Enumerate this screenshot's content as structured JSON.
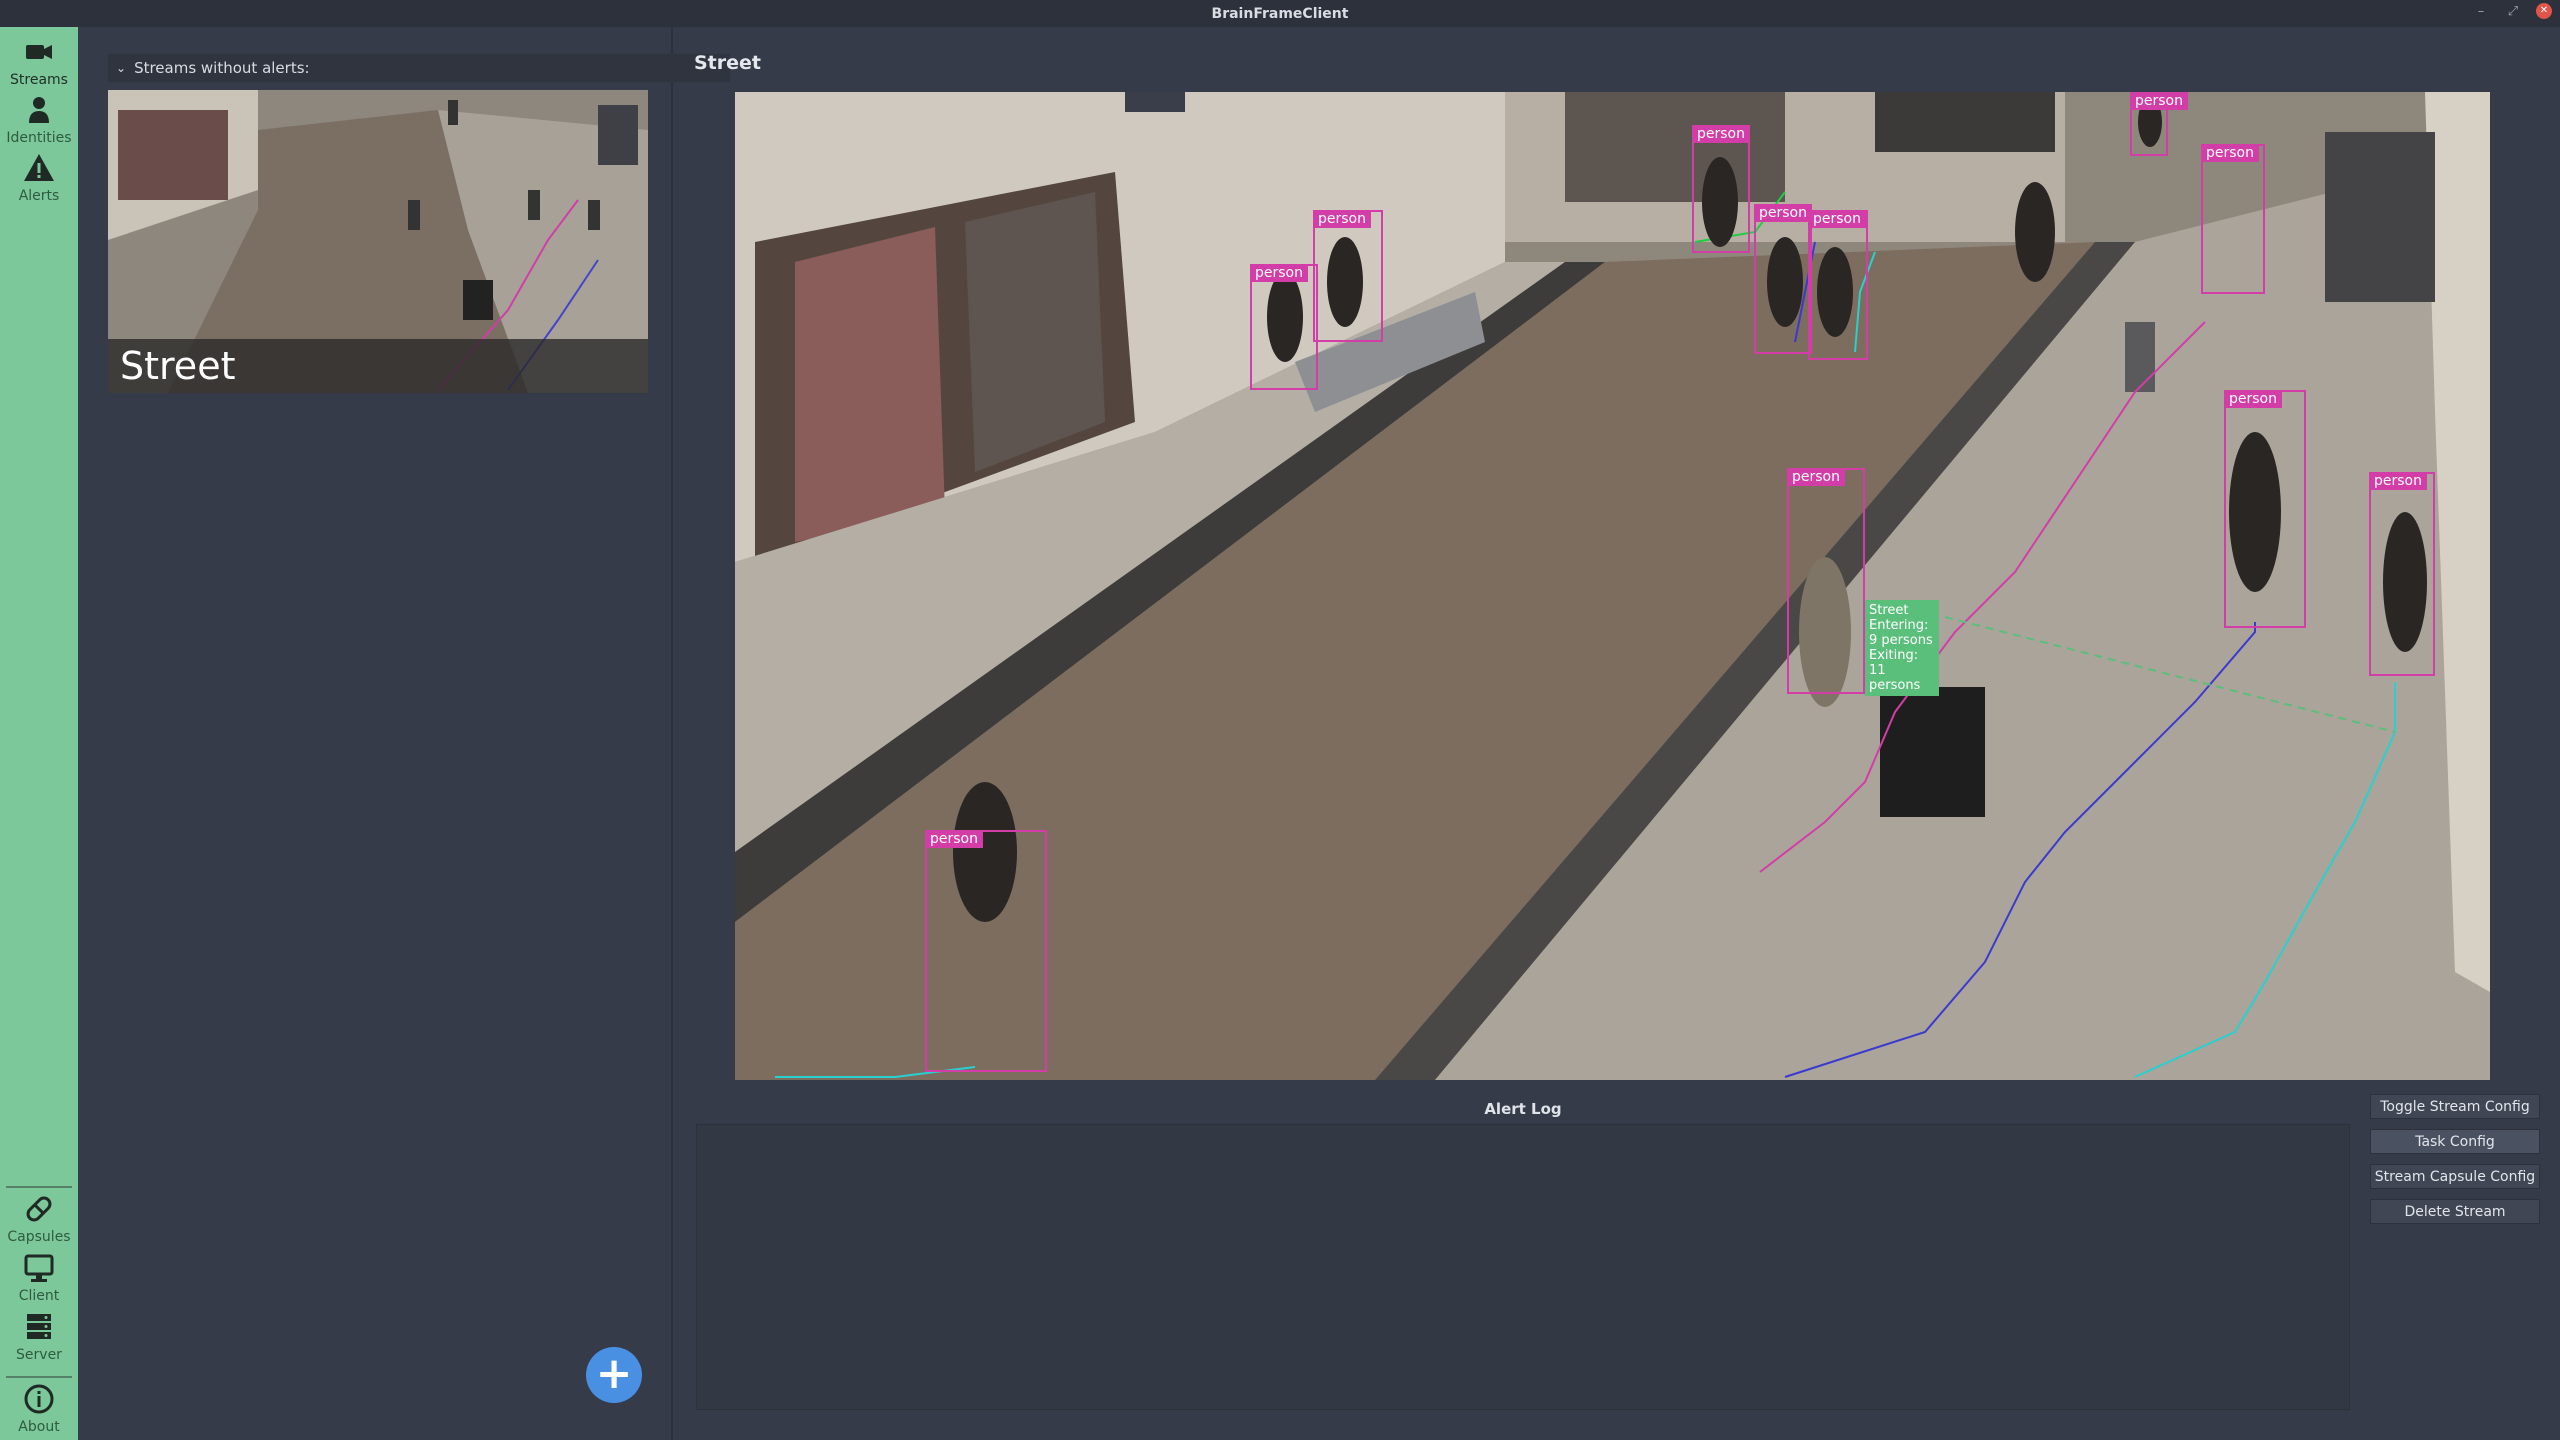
{
  "window": {
    "title": "BrainFrameClient"
  },
  "sidebar": {
    "top_items": [
      {
        "label": "Streams",
        "icon": "video-camera-icon"
      },
      {
        "label": "Identities",
        "icon": "person-icon"
      },
      {
        "label": "Alerts",
        "icon": "warning-icon"
      }
    ],
    "bottom_items": [
      {
        "label": "Capsules",
        "icon": "capsule-icon"
      },
      {
        "label": "Client",
        "icon": "monitor-icon"
      },
      {
        "label": "Server",
        "icon": "server-icon"
      },
      {
        "label": "About",
        "icon": "info-icon"
      }
    ]
  },
  "streams_panel": {
    "group_label": "Streams without alerts:",
    "streams": [
      {
        "name": "Street"
      }
    ],
    "add_button": "+"
  },
  "stream_view": {
    "title": "Street",
    "detection_label": "person",
    "zone_label": [
      "Street",
      "Entering:",
      "9 persons",
      "Exiting:",
      "11 persons"
    ]
  },
  "alert_log": {
    "title": "Alert Log"
  },
  "actions": [
    {
      "label": "Toggle Stream Config"
    },
    {
      "label": "Task Config"
    },
    {
      "label": "Stream Capsule Config"
    },
    {
      "label": "Delete Stream"
    }
  ],
  "colors": {
    "sidebar": "#7cc89a",
    "detection": "#d23da8",
    "zone": "#5bbf7c",
    "add_button": "#4a90e2"
  }
}
